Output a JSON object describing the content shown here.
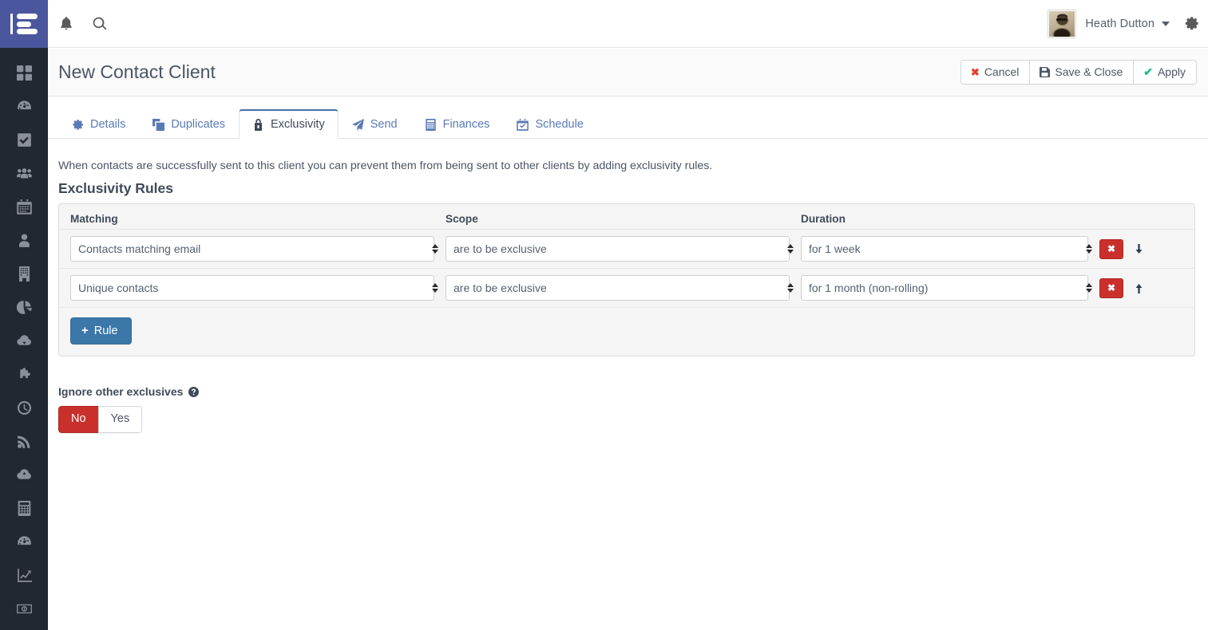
{
  "sidebar": {
    "logo_name": "app-logo",
    "items": [
      {
        "icon": "grid-dashboard-icon",
        "label": "Dashboard"
      },
      {
        "icon": "gauge-icon",
        "label": "Performance"
      },
      {
        "icon": "check-square-icon",
        "label": "Tasks"
      },
      {
        "icon": "users-icon",
        "label": "Contacts"
      },
      {
        "icon": "calendar-icon",
        "label": "Calendar"
      },
      {
        "icon": "user-icon",
        "label": "People"
      },
      {
        "icon": "building-icon",
        "label": "Companies"
      },
      {
        "icon": "pie-chart-icon",
        "label": "Reports"
      },
      {
        "icon": "cloud-download-icon",
        "label": "Imports"
      },
      {
        "icon": "puzzle-piece-icon",
        "label": "Integrations"
      },
      {
        "icon": "clock-icon",
        "label": "History"
      },
      {
        "icon": "rss-icon",
        "label": "Feeds"
      },
      {
        "icon": "cloud-upload-icon",
        "label": "Exports"
      },
      {
        "icon": "calculator-icon",
        "label": "Finances"
      },
      {
        "icon": "tachometer-icon",
        "label": "Monitoring"
      },
      {
        "icon": "line-chart-icon",
        "label": "Analytics"
      },
      {
        "icon": "money-icon",
        "label": "Billing"
      }
    ]
  },
  "topbar": {
    "bell_icon": "bell-icon",
    "search_icon": "search-icon",
    "user_name": "Heath Dutton",
    "avatar_name": "user-avatar",
    "settings_icon": "gear-icon"
  },
  "page": {
    "title": "New Contact Client",
    "actions": [
      {
        "id": "cancel",
        "label": "Cancel",
        "icon": "times-icon",
        "color": "#e8402a"
      },
      {
        "id": "save-close",
        "label": "Save & Close",
        "icon": "floppy-disk-icon",
        "color": "#4b5563"
      },
      {
        "id": "apply",
        "label": "Apply",
        "icon": "check-icon",
        "color": "#18bc9c"
      }
    ]
  },
  "tabs": [
    {
      "id": "details",
      "label": "Details",
      "icon": "gear-icon",
      "active": false
    },
    {
      "id": "duplicates",
      "label": "Duplicates",
      "icon": "clone-icon",
      "active": false
    },
    {
      "id": "exclusivity",
      "label": "Exclusivity",
      "icon": "lock-icon",
      "active": true
    },
    {
      "id": "send",
      "label": "Send",
      "icon": "paper-plane-icon",
      "active": false
    },
    {
      "id": "finances",
      "label": "Finances",
      "icon": "calculator-icon",
      "active": false
    },
    {
      "id": "schedule",
      "label": "Schedule",
      "icon": "calendar-check-icon",
      "active": false
    }
  ],
  "main": {
    "intro": "When contacts are successfully sent to this client you can prevent them from being sent to other clients by adding exclusivity rules.",
    "section_title": "Exclusivity Rules",
    "columns": {
      "matching": "Matching",
      "scope": "Scope",
      "duration": "Duration"
    },
    "rules": [
      {
        "matching": "Contacts matching email",
        "scope": "are to be exclusive",
        "duration": "for 1 week",
        "delete_label": "✖",
        "move_icon": "arrow-down-icon"
      },
      {
        "matching": "Unique contacts",
        "scope": "are to be exclusive",
        "duration": "for 1 month (non-rolling)",
        "delete_label": "✖",
        "move_icon": "arrow-up-icon"
      }
    ],
    "add_rule_label": "Rule",
    "add_rule_plus": "+",
    "ignore": {
      "label": "Ignore other exclusives",
      "help_icon": "question-circle-icon",
      "options": [
        {
          "id": "no",
          "label": "No",
          "selected": true
        },
        {
          "id": "yes",
          "label": "Yes",
          "selected": false
        }
      ]
    }
  },
  "colors": {
    "logo_bg": "#4a569d",
    "rail_bg": "#222831",
    "tab_link": "#5b7ab5",
    "tab_active_border": "#4a6fa5",
    "danger": "#c9302c",
    "primary_button": "#3b77a8",
    "cancel_icon": "#e8402a",
    "apply_icon": "#18bc9c"
  }
}
